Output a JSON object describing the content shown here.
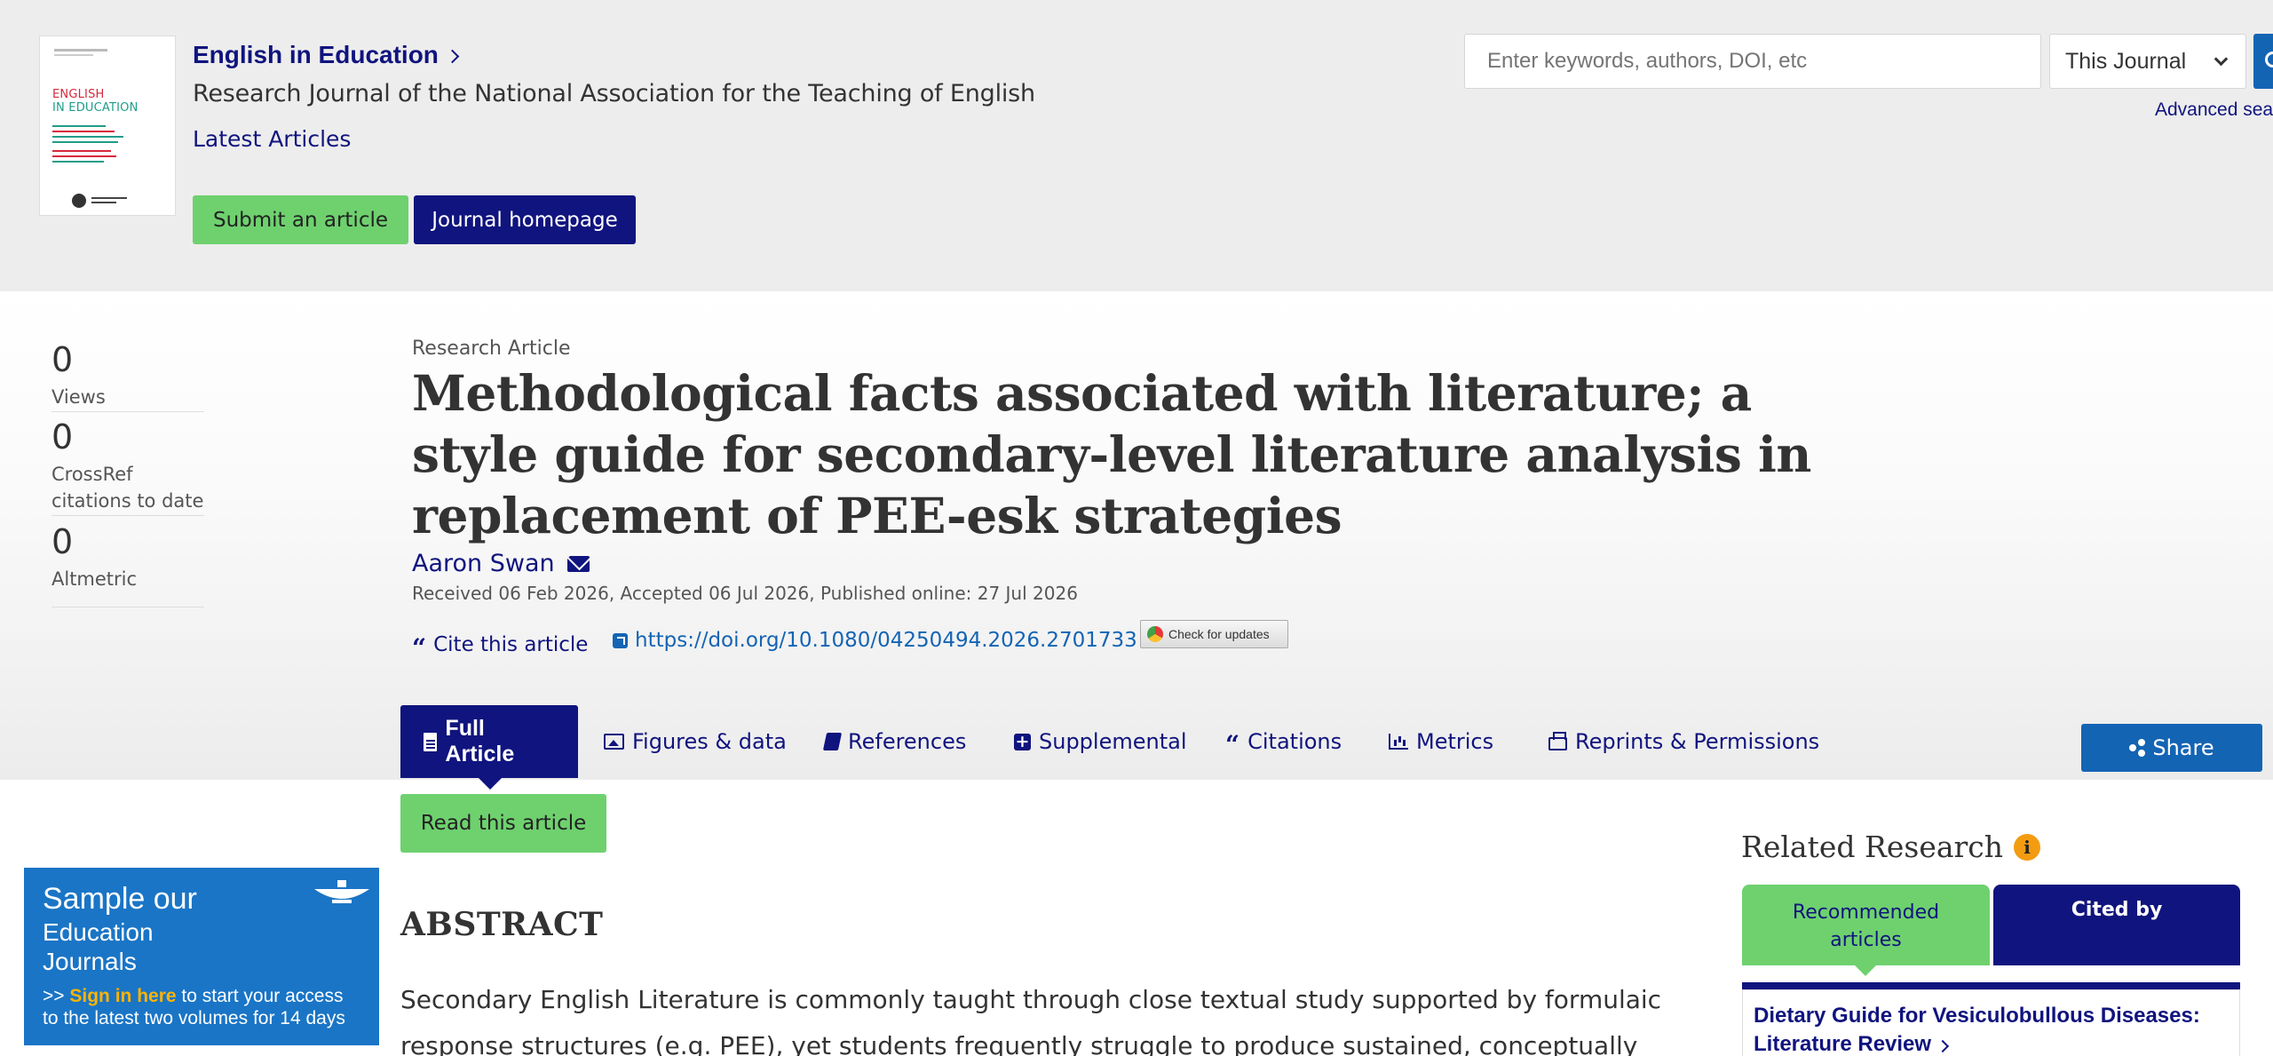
{
  "journal": {
    "name": "English in Education",
    "subtitle": "Research Journal of the National Association for the Teaching of English",
    "latest_link": "Latest Articles",
    "submit_label": "Submit an article",
    "homepage_label": "Journal homepage",
    "cover": {
      "title_line1": "ENGLISH",
      "title_line2": "IN EDUCATION"
    }
  },
  "search": {
    "placeholder": "Enter keywords, authors, DOI, etc",
    "scope_value": "This Journal",
    "advanced_label": "Advanced sea"
  },
  "metrics": [
    {
      "value": "0",
      "label": "Views"
    },
    {
      "value": "0",
      "label": "CrossRef citations to date"
    },
    {
      "value": "0",
      "label": "Altmetric"
    }
  ],
  "article": {
    "type": "Research Article",
    "title": "Methodological facts associated with literature; a style guide for secondary-level literature analysis in replacement of PEE-esk strategies",
    "author": "Aaron Swan",
    "dates": "Received 06 Feb 2026, Accepted 06 Jul 2026, Published online: 27 Jul 2026",
    "cite_label": "Cite this article",
    "doi": "https://doi.org/10.1080/04250494.2026.2701733",
    "check_updates": "Check for updates"
  },
  "tabs": [
    {
      "label": "Full Article",
      "icon": "document-icon",
      "active": true
    },
    {
      "label": "Figures & data",
      "icon": "image-icon"
    },
    {
      "label": "References",
      "icon": "book-icon"
    },
    {
      "label": "Supplemental",
      "icon": "plus-square-icon"
    },
    {
      "label": "Citations",
      "icon": "quote-icon"
    },
    {
      "label": "Metrics",
      "icon": "bar-chart-icon"
    },
    {
      "label": "Reprints & Permissions",
      "icon": "print-icon"
    }
  ],
  "share_label": "Share",
  "read_label": "Read this article",
  "ad": {
    "line1": "Sample our",
    "line2": "Education",
    "line3": "Journals",
    "prefix": ">> ",
    "signin": "Sign in here",
    "rest1": " to start your access",
    "rest2": "to the latest two volumes for 14 days"
  },
  "abstract": {
    "heading": "ABSTRACT",
    "text": "Secondary English Literature is commonly taught through close textual study supported by formulaic response structures (e.g. PEE), yet students frequently struggle to produce sustained, conceptually"
  },
  "related": {
    "title": "Related Research",
    "tab_recommended": "Recommended articles",
    "tab_cited": "Cited by",
    "first_item": "Dietary Guide for Vesiculobullous Diseases: Literature Review"
  },
  "colors": {
    "brand_navy": "#10147e",
    "accent_green": "#6ed16e",
    "link_blue": "#1464b4",
    "header_grey": "#ededed"
  }
}
